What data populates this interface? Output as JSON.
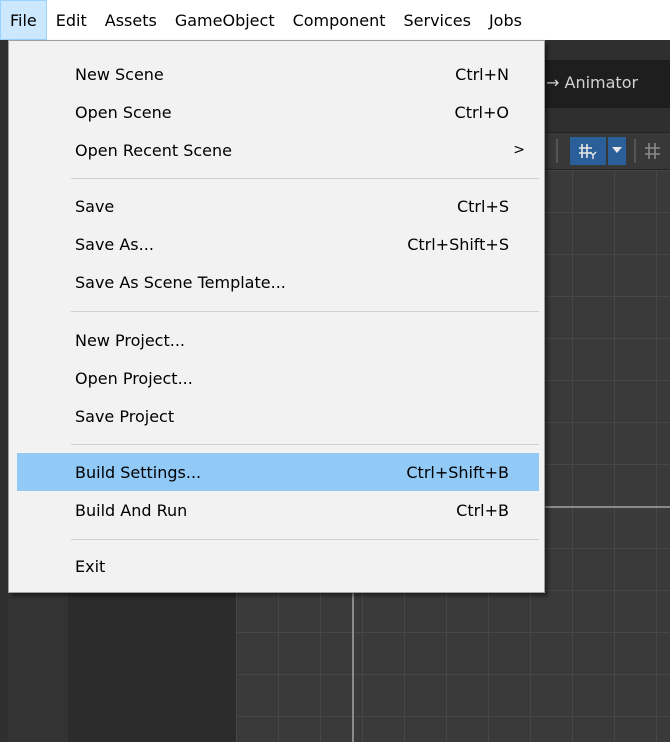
{
  "menubar": {
    "items": [
      "File",
      "Edit",
      "Assets",
      "GameObject",
      "Component",
      "Services",
      "Jobs"
    ]
  },
  "editor": {
    "tab_label": "→ Animator",
    "toolbar_grid_icon": "grid-snap-icon",
    "toolbar_dropdown_icon": "dropdown-arrow-icon"
  },
  "file_menu": {
    "items": [
      {
        "label": "New Scene",
        "shortcut": "Ctrl+N"
      },
      {
        "label": "Open Scene",
        "shortcut": "Ctrl+O"
      },
      {
        "label": "Open Recent Scene",
        "shortcut": "",
        "submenu": true,
        "arrow": ">"
      },
      {
        "label": "Save",
        "shortcut": "Ctrl+S"
      },
      {
        "label": "Save As...",
        "shortcut": "Ctrl+Shift+S"
      },
      {
        "label": "Save As Scene Template...",
        "shortcut": ""
      },
      {
        "label": "New Project...",
        "shortcut": ""
      },
      {
        "label": "Open Project...",
        "shortcut": ""
      },
      {
        "label": "Save Project",
        "shortcut": ""
      },
      {
        "label": "Build Settings...",
        "shortcut": "Ctrl+Shift+B",
        "highlighted": true
      },
      {
        "label": "Build And Run",
        "shortcut": "Ctrl+B"
      },
      {
        "label": "Exit",
        "shortcut": ""
      }
    ]
  },
  "colors": {
    "menubar_bg": "#ffffff",
    "active_menu_bg": "#cce8ff",
    "dropdown_bg": "#f2f2f2",
    "highlight_bg": "#91c9f7",
    "editor_bg": "#2f2f2f"
  }
}
